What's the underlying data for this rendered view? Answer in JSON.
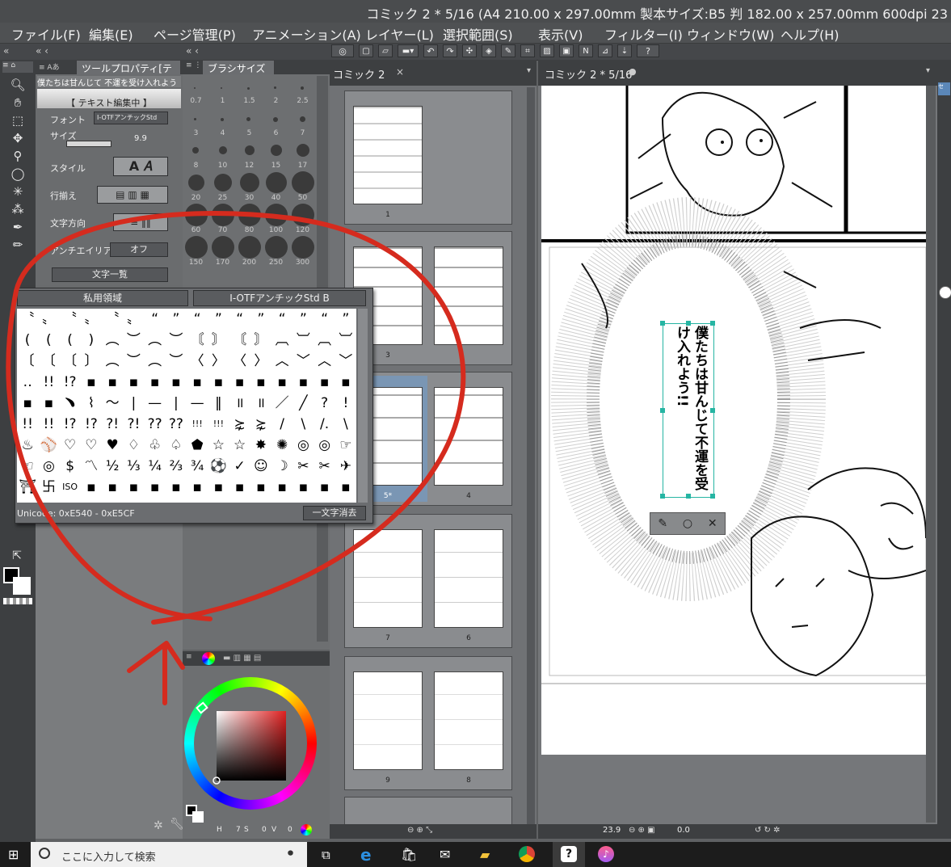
{
  "window": {
    "title": "コミック 2 * 5/16 (A4 210.00 x 297.00mm 製本サイズ:B5 判 182.00 x 257.00mm 600dpi 23"
  },
  "menu": [
    "ファイル(F)",
    "編集(E)",
    "ページ管理(P)",
    "アニメーション(A)",
    "レイヤー(L)",
    "選択範囲(S)",
    "表示(V)",
    "フィルター(I)",
    "ウィンドウ(W)",
    "ヘルプ(H)"
  ],
  "tool_property": {
    "tab_label": "ツールプロパティ[テ",
    "text_preview": "僕たちは甘んじて 不運を受け入れよう",
    "editing_label": "【 テキスト編集中 】",
    "font_label": "フォント",
    "font_value": "I-OTFアンチックStd",
    "size_label": "サイズ",
    "size_value": "9.9",
    "style_label": "スタイル",
    "align_label": "行揃え",
    "direction_label": "文字方向",
    "antialias_label": "アンチエイリアス",
    "antialias_value": "オフ",
    "charlist_button": "文字一覧"
  },
  "brush_size": {
    "tab_label": "ブラシサイズ",
    "sizes": [
      "0.7",
      "1",
      "1.5",
      "2",
      "2.5",
      "3",
      "4",
      "5",
      "6",
      "7",
      "8",
      "10",
      "12",
      "15",
      "17",
      "20",
      "25",
      "30",
      "40",
      "50",
      "60",
      "70",
      "80",
      "100",
      "120",
      "150",
      "170",
      "200",
      "250",
      "300"
    ]
  },
  "char_list": {
    "range_label": "私用領域",
    "font_label": "I-OTFアンチックStd B",
    "unicode_label": "Unicode: 0xE540 - 0xE5CF",
    "delete_button": "一文字消去",
    "rows": [
      [
        "〝",
        "〟",
        "〝",
        "〟",
        "〝",
        "〟",
        "“",
        "”",
        "“",
        "”",
        "“",
        "”",
        "“",
        "”",
        "“",
        "”"
      ],
      [
        "(",
        "(",
        "(",
        ")",
        "︵",
        "︶",
        "︵",
        "︶",
        "〘",
        "〙",
        "〘",
        "〙",
        "︹",
        "︺",
        "︹",
        "︺"
      ],
      [
        "〔",
        "〔",
        "〔",
        "〕",
        "︵",
        "︶",
        "︵",
        "︶",
        "〈",
        "〉",
        "〈",
        "〉",
        "︿",
        "﹀",
        "︿",
        "﹀"
      ],
      [
        "‥",
        "!!",
        "!?",
        "▪",
        "▪",
        "▪",
        "▪",
        "▪",
        "▪",
        "▪",
        "▪",
        "▪",
        "▪",
        "▪",
        "▪",
        "▪"
      ],
      [
        "▪",
        "▪",
        "﹅",
        "⌇",
        "〜",
        "|",
        "—",
        "|",
        "—",
        "‖",
        "॥",
        "॥",
        "／",
        "╱",
        "?",
        "!"
      ],
      [
        "!!",
        "!!",
        "!?",
        "!?",
        "?!",
        "?!",
        "??",
        "??",
        "!!!",
        "!!!",
        "⋩",
        "⋩",
        "/",
        "\\",
        "/.",
        "\\"
      ],
      [
        "♨",
        "⚾",
        "♡",
        "♡",
        "♥",
        "♢",
        "♧",
        "♤",
        "⬟",
        "☆",
        "☆",
        "✸",
        "✺",
        "◎",
        "◎",
        "☞"
      ],
      [
        "☜",
        "◎",
        "$",
        "〽",
        "½",
        "⅓",
        "¼",
        "⅔",
        "¾",
        "⚽",
        "✓",
        "☺",
        "☽",
        "✂",
        "✂",
        "✈"
      ],
      [
        "⛩",
        "卐",
        "ISO",
        "▪",
        "▪",
        "▪",
        "▪",
        "▪",
        "▪",
        "▪",
        "▪",
        "▪",
        "▪",
        "▪",
        "▪",
        "▪"
      ]
    ]
  },
  "page_manager": {
    "tab_label": "コミック 2",
    "pages": [
      "1",
      "3",
      "5*",
      "4",
      "7",
      "6",
      "9",
      "8"
    ]
  },
  "canvas": {
    "tab_label": "コミック 2 * 5/16",
    "speech_text": "僕たちは甘んじて不運を受け入れよう!!",
    "zoom": "23.9",
    "rotation": "0.0"
  },
  "color_panel": {
    "hue_values": [
      "7",
      "0",
      "0"
    ]
  },
  "taskbar": {
    "search_placeholder": "ここに入力して検索"
  },
  "colors": {
    "accent_red": "#d52b1e",
    "selection": "#26b5a3",
    "panel": "#6a6c6e"
  }
}
